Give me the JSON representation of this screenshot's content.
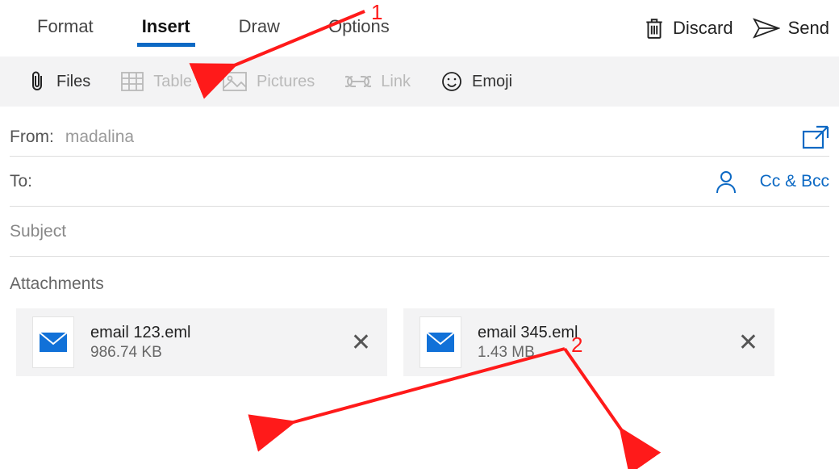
{
  "tabs": {
    "format": "Format",
    "insert": "Insert",
    "draw": "Draw",
    "options": "Options"
  },
  "actions": {
    "discard": "Discard",
    "send": "Send"
  },
  "toolbar": {
    "files": "Files",
    "table": "Table",
    "pictures": "Pictures",
    "link": "Link",
    "emoji": "Emoji"
  },
  "compose": {
    "from_label": "From:",
    "from_value": "madalina",
    "to_label": "To:",
    "ccbcc": "Cc & Bcc",
    "subject": "Subject",
    "attachments_label": "Attachments"
  },
  "attachments": [
    {
      "name": "email 123.eml",
      "size": "986.74 KB"
    },
    {
      "name": "email 345.eml",
      "size": "1.43 MB"
    }
  ],
  "annotations": {
    "label1": "1",
    "label2": "2"
  }
}
